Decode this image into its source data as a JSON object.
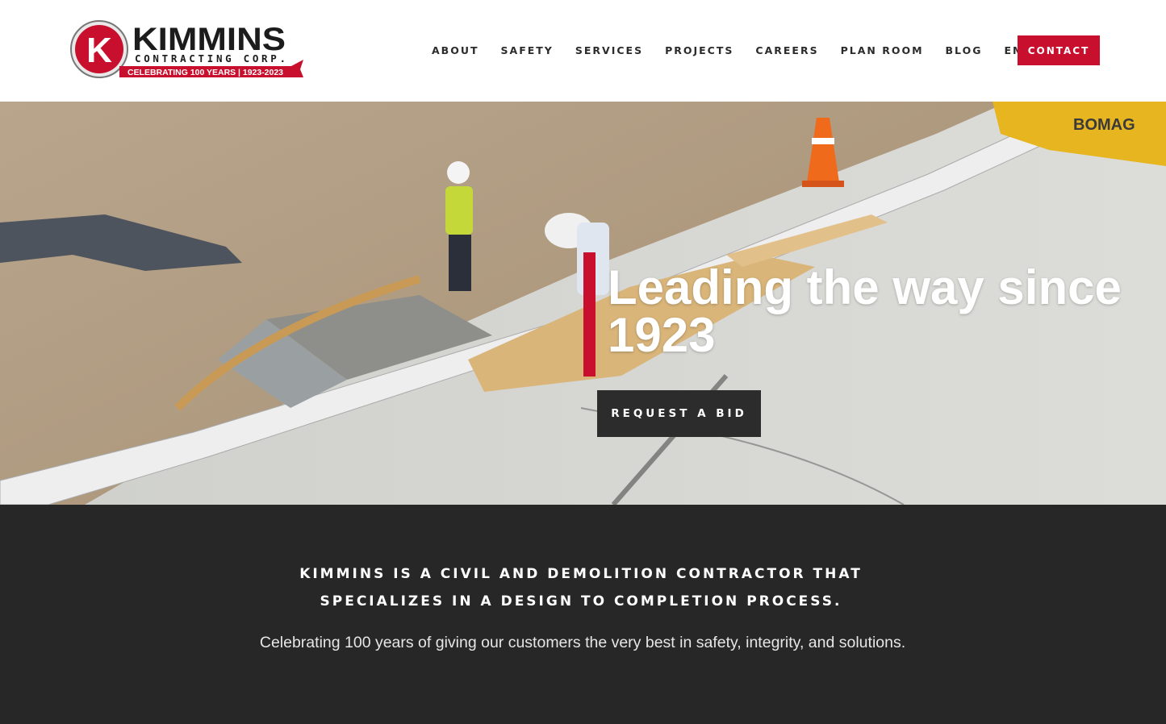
{
  "brand": {
    "name": "KIMMINS",
    "subtitle": "CONTRACTING CORP.",
    "banner": "CELEBRATING 100 YEARS | 1923-2023",
    "monogram": "K",
    "primary_color": "#c8102e"
  },
  "nav": {
    "items": [
      {
        "label": "ABOUT"
      },
      {
        "label": "SAFETY"
      },
      {
        "label": "SERVICES"
      },
      {
        "label": "PROJECTS"
      },
      {
        "label": "CAREERS"
      },
      {
        "label": "PLAN ROOM"
      },
      {
        "label": "BLOG"
      },
      {
        "label": "EMPLOYEES"
      }
    ],
    "contact_label": "CONTACT"
  },
  "hero": {
    "title": "Leading the way since 1923",
    "cta_label": "REQUEST A BID",
    "equipment_label": "BOMAG"
  },
  "intro": {
    "heading_line1": "KIMMINS IS A CIVIL AND DEMOLITION CONTRACTOR THAT",
    "heading_line2": "SPECIALIZES IN A DESIGN TO COMPLETION PROCESS.",
    "subtext": "Celebrating 100 years of giving our customers the very best in safety, integrity, and solutions."
  }
}
